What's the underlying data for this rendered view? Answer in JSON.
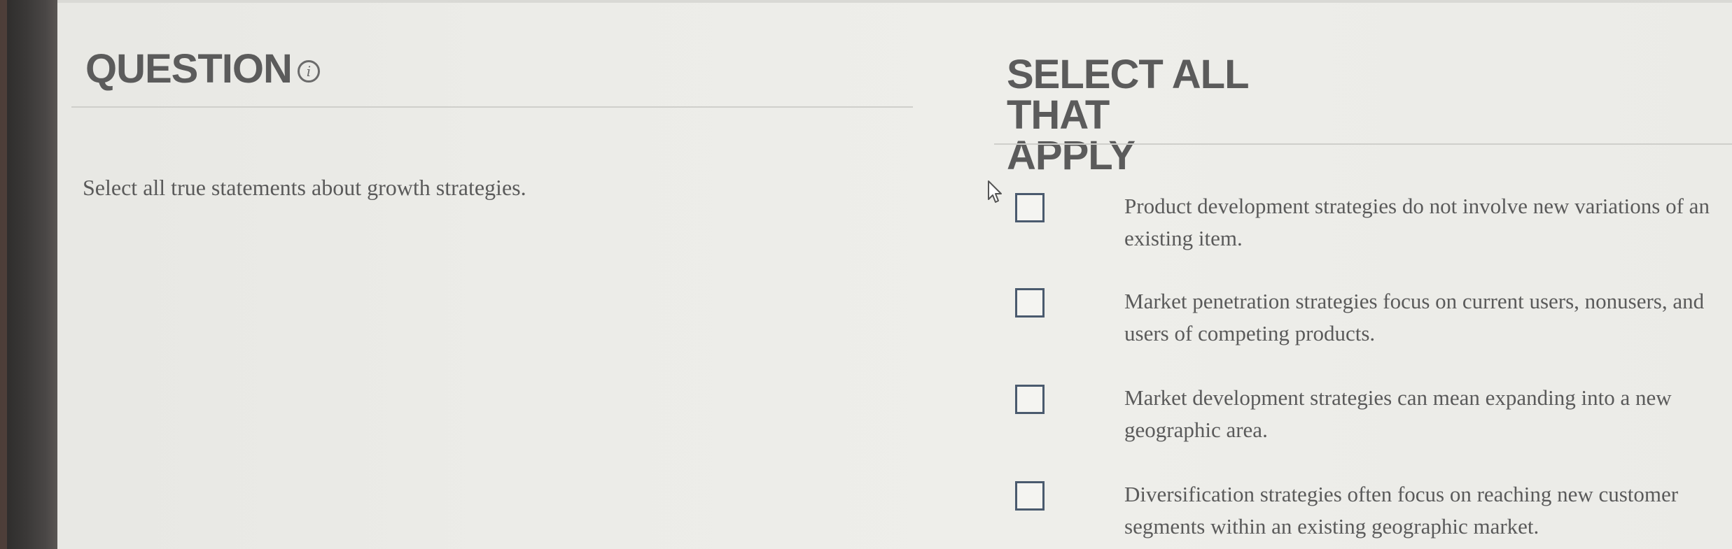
{
  "question_header": {
    "title": "QUESTION",
    "info_icon": "info-icon",
    "info_glyph": "i"
  },
  "answer_header": {
    "title_line1": "SELECT ALL THAT",
    "title_line2": "APPLY"
  },
  "question": {
    "prompt": "Select all true statements about growth strategies."
  },
  "options": [
    {
      "text": "Product development strategies do not involve new variations of an existing item.",
      "checked": false
    },
    {
      "text": "Market penetration strategies focus on current users, nonusers, and users of competing products.",
      "checked": false
    },
    {
      "text": "Market development strategies can mean expanding into a new geographic area.",
      "checked": false
    },
    {
      "text": "Diversification strategies often focus on reaching new customer segments within an existing geographic market.",
      "checked": false
    }
  ],
  "colors": {
    "background": "#ecece8",
    "heading_text": "#5b5b5b",
    "body_text": "#5a5a5a",
    "checkbox_border": "#4a5a6e",
    "divider": "#cfcfcb"
  }
}
